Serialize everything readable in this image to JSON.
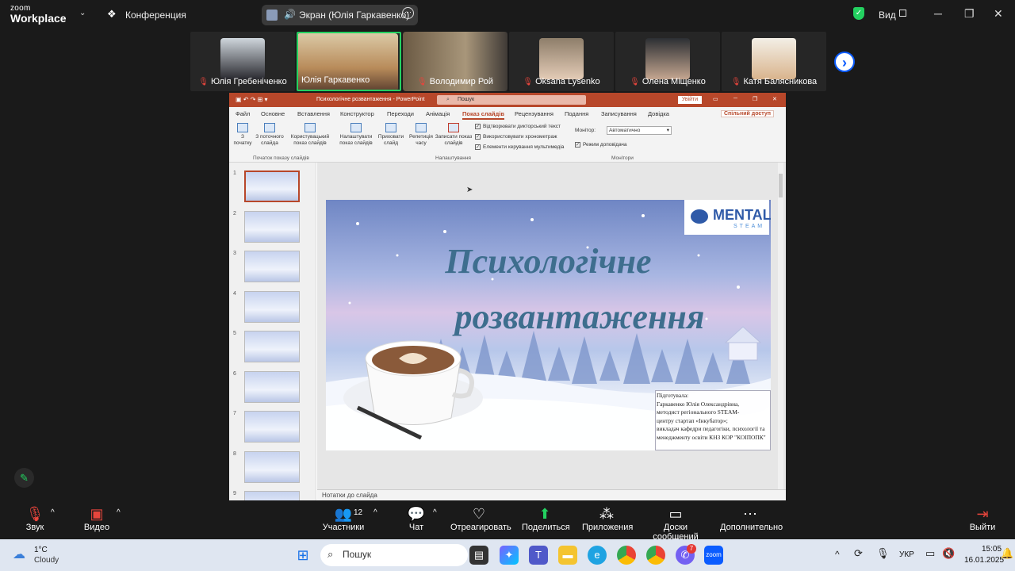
{
  "topbar": {
    "logo_top": "zoom",
    "logo_bottom": "Workplace",
    "meeting_label": "Конференция",
    "share_label": "Экран (Юлія Гаркавенко)",
    "view_label": "Вид"
  },
  "participants": [
    {
      "name": "Юлія Гребеніченко",
      "muted": true
    },
    {
      "name": "Юлія Гаркавенко",
      "muted": false
    },
    {
      "name": "Володимир Рой",
      "muted": true
    },
    {
      "name": "Oksana Lysenko",
      "muted": true
    },
    {
      "name": "Олена Міщенко",
      "muted": true
    },
    {
      "name": "Катя Балясникова",
      "muted": true
    }
  ],
  "ppt": {
    "title": "Психологічне розвантаження  -  PowerPoint",
    "search_placeholder": "Пошук",
    "signin": "Увійти",
    "share": "Спільний доступ",
    "tabs": [
      "Файл",
      "Основне",
      "Вставлення",
      "Конструктор",
      "Переходи",
      "Анімація",
      "Показ слайдів",
      "Рецензування",
      "Подання",
      "Записування",
      "Довідка"
    ],
    "selected_tab": "Показ слайдів",
    "ribbon": {
      "from_start": "З початку",
      "from_current": "З поточного слайда",
      "custom_show": "Користувацький показ слайдів",
      "group_start": "Початок показу слайдів",
      "setup": "Налаштувати показ слайдів",
      "hide": "Приховати слайд",
      "rehearse": "Репетиція часу",
      "record": "Записати показ слайдів",
      "chk1": "Відтворювати дикторський текст",
      "chk2": "Використовувати хронометраж",
      "chk3": "Елементи керування мультимедіа",
      "group_setup": "Налаштування",
      "monitor_label": "Монітор:",
      "monitor_value": "Автоматично",
      "presenter_view": "Режим доповідача",
      "group_monitors": "Монітори"
    },
    "thumb_numbers": [
      "1",
      "2",
      "3",
      "4",
      "5",
      "6",
      "7",
      "8",
      "9"
    ],
    "notes": "Нотатки до слайда",
    "slide": {
      "title_line1": "Психологічне",
      "title_line2": "розвантаження",
      "logo_main": "MENTAL",
      "logo_sub": "STEAM",
      "credit": [
        "Підготувала:",
        "Гаркавенко Юлія Олександрівна,",
        "методист регіонального STEAM-",
        "центру стартап «Інкубатор»;",
        "викладач кафедри педагогіки, психології та",
        "менеджменту освіти КНЗ КОР \"КОІПОПК\""
      ]
    }
  },
  "toolbar": {
    "audio": "Звук",
    "video": "Видео",
    "participants": "Участники",
    "participants_count": "12",
    "chat": "Чат",
    "react": "Отреагировать",
    "share": "Поделиться",
    "apps": "Приложения",
    "whiteboards": "Доски сообщений",
    "more": "Дополнительно",
    "leave": "Выйти"
  },
  "taskbar": {
    "weather_temp": "1°C",
    "weather_desc": "Cloudy",
    "search": "Пошук",
    "lang": "УКР",
    "time": "15:05",
    "date": "16.01.2025",
    "zoom_badge": "7"
  },
  "colors": {
    "ppt_accent": "#b7472a",
    "zoom_green": "#23d160",
    "zoom_blue": "#0b5cff"
  }
}
